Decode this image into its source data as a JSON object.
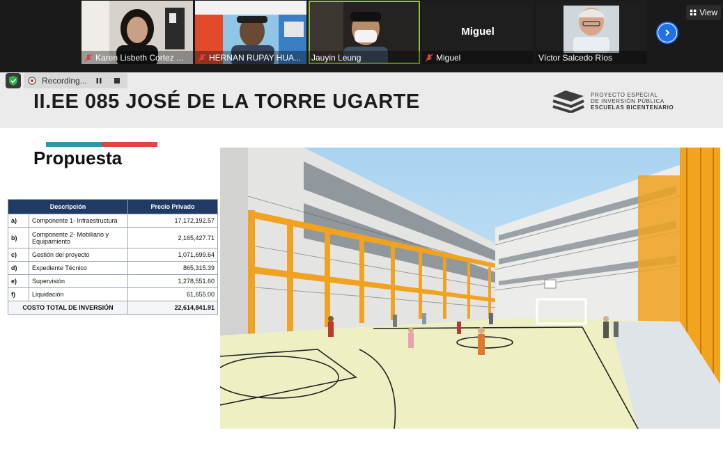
{
  "participants": [
    {
      "name": "Karen Lisbeth Cortez ...",
      "muted": true
    },
    {
      "name": "HERNAN RUPAY HUA...",
      "muted": true
    },
    {
      "name": "Jauyin Leung",
      "muted": false,
      "active": true
    },
    {
      "name": "Miguel",
      "muted": true,
      "display_name": "Miguel"
    },
    {
      "name": "Víctor Salcedo Ríos",
      "muted": false
    }
  ],
  "toolbar": {
    "view_label": "View"
  },
  "recording": {
    "label": "Recording..."
  },
  "slide": {
    "title": "II.EE 085 JOSÉ DE LA TORRE UGARTE",
    "logo_lines": [
      "PROYECTO ESPECIAL",
      "DE INVERSIÓN PÚBLICA",
      "ESCUELAS BICENTENARIO"
    ],
    "section": "Propuesta",
    "accent_colors": [
      "#2f97a8",
      "#e0453f"
    ],
    "table": {
      "headers": [
        "Descripción",
        "Precio Privado"
      ],
      "rows": [
        {
          "idx": "a)",
          "desc": "Componente 1- Infraestructura",
          "val": "17,172,192.57"
        },
        {
          "idx": "b)",
          "desc": "Componente 2- Mobiliario y Equipamiento",
          "val": "2,165,427.71"
        },
        {
          "idx": "c)",
          "desc": "Gestión del proyecto",
          "val": "1,071,699.64"
        },
        {
          "idx": "d)",
          "desc": "Expediente Técnico",
          "val": "865,315.39"
        },
        {
          "idx": "e)",
          "desc": "Supervisión",
          "val": "1,278,551.60"
        },
        {
          "idx": "f)",
          "desc": "Liquidación",
          "val": "61,655.00"
        }
      ],
      "total_label": "COSTO TOTAL DE INVERSIÓN",
      "total_value": "22,614,841.91"
    }
  }
}
